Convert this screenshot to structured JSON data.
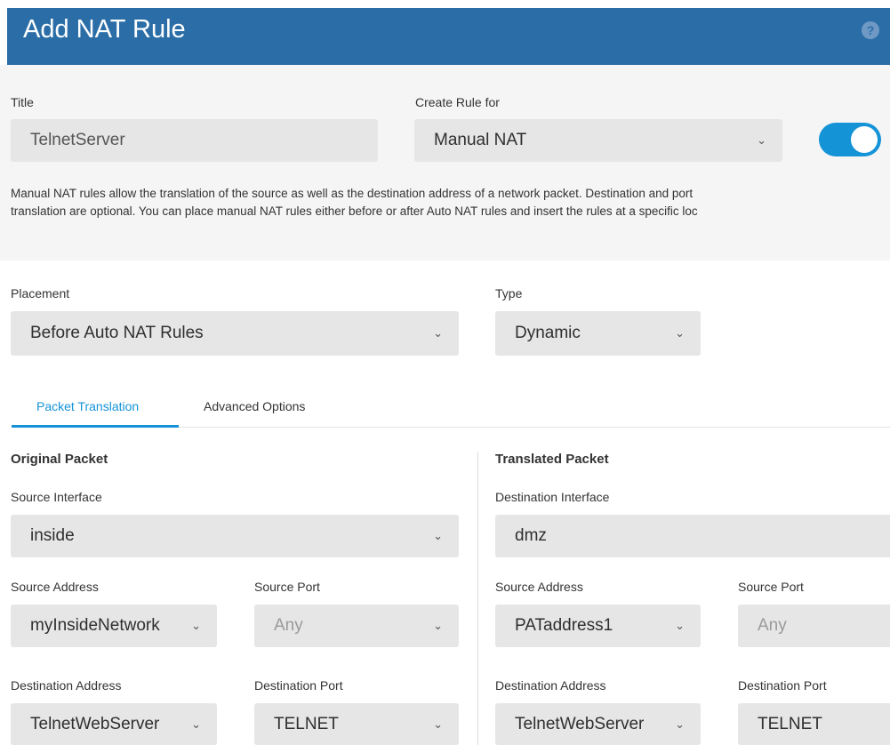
{
  "dialog": {
    "title": "Add NAT Rule",
    "help_icon": "help-icon",
    "help_glyph": "?"
  },
  "form": {
    "title_label": "Title",
    "title_value": "TelnetServer",
    "create_rule_label": "Create Rule for",
    "create_rule_value": "Manual NAT",
    "enabled": true,
    "description_line1": "Manual NAT rules allow the translation of the source as well as the destination address of a network packet. Destination and port",
    "description_line2": "translation are optional. You can place manual NAT rules either before or after Auto NAT rules and insert the rules at a specific loc",
    "placement_label": "Placement",
    "placement_value": "Before Auto NAT Rules",
    "type_label": "Type",
    "type_value": "Dynamic"
  },
  "tabs": [
    {
      "label": "Packet Translation",
      "active": true
    },
    {
      "label": "Advanced Options",
      "active": false
    }
  ],
  "original": {
    "heading": "Original Packet",
    "source_interface_label": "Source Interface",
    "source_interface_value": "inside",
    "source_address_label": "Source Address",
    "source_address_value": "myInsideNetwork",
    "source_port_label": "Source Port",
    "source_port_value": "Any",
    "dest_address_label": "Destination Address",
    "dest_address_value": "TelnetWebServer",
    "dest_port_label": "Destination Port",
    "dest_port_value": "TELNET"
  },
  "translated": {
    "heading": "Translated Packet",
    "dest_interface_label": "Destination Interface",
    "dest_interface_value": "dmz",
    "source_address_label": "Source Address",
    "source_address_value": "PATaddress1",
    "source_port_label": "Source Port",
    "source_port_value": "Any",
    "dest_address_label": "Destination Address",
    "dest_address_value": "TelnetWebServer",
    "dest_port_label": "Destination Port",
    "dest_port_value": "TELNET"
  },
  "colors": {
    "header": "#2b6ea7",
    "accent": "#1493d7",
    "field_bg": "#e6e6e6",
    "panel_bg": "#f5f5f5"
  },
  "icons": {
    "dropdown": "chevron-down-icon",
    "chevron_glyph": "⌄"
  }
}
